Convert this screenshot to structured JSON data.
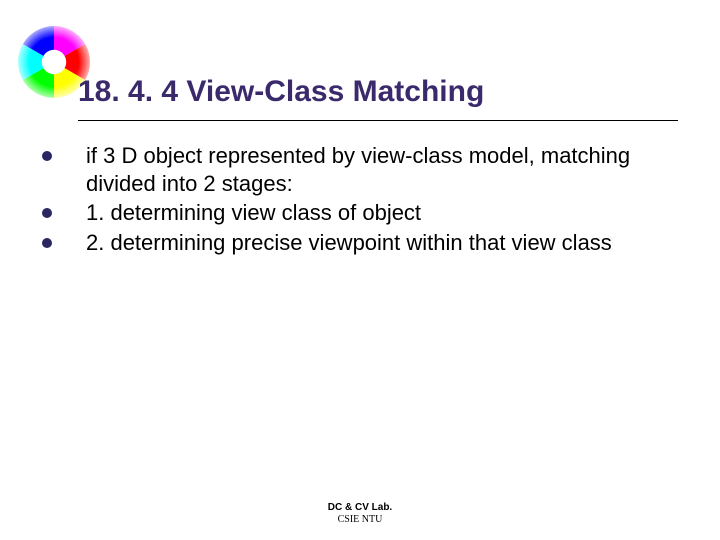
{
  "title": "18. 4. 4 View-Class Matching",
  "bullets": [
    "if 3 D object represented by view-class model, matching divided into 2 stages:",
    "1. determining view class of object",
    "2. determining precise viewpoint within that view class"
  ],
  "footer": {
    "line1": "DC & CV Lab.",
    "line2": "CSIE NTU"
  }
}
